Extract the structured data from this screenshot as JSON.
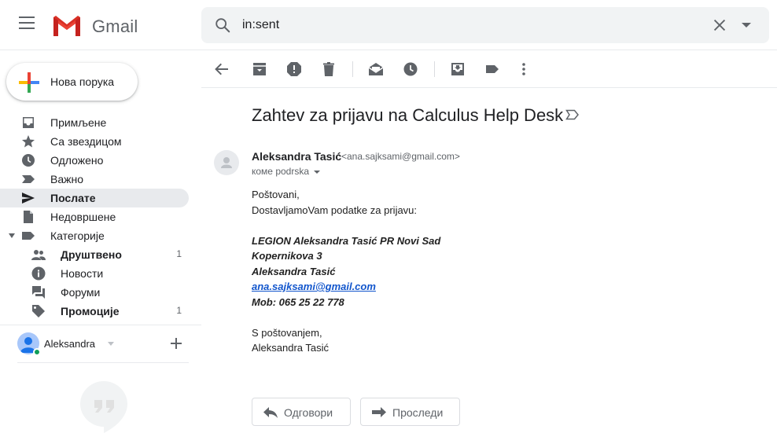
{
  "header": {
    "app_name": "Gmail",
    "search_value": "in:sent"
  },
  "sidebar": {
    "compose_label": "Нова порука",
    "items": [
      {
        "label": "Примљене",
        "icon": "inbox-icon"
      },
      {
        "label": "Са звездицом",
        "icon": "star-icon"
      },
      {
        "label": "Одложено",
        "icon": "clock-icon"
      },
      {
        "label": "Важно",
        "icon": "important-icon"
      },
      {
        "label": "Послате",
        "icon": "send-icon"
      },
      {
        "label": "Недовршене",
        "icon": "draft-icon"
      },
      {
        "label": "Категорије",
        "icon": "label-icon"
      }
    ],
    "categories": [
      {
        "label": "Друштвено",
        "count": "1",
        "icon": "people-icon"
      },
      {
        "label": "Новости",
        "count": "",
        "icon": "info-icon"
      },
      {
        "label": "Форуми",
        "count": "",
        "icon": "forum-icon"
      },
      {
        "label": "Промоције",
        "count": "1",
        "icon": "tag-icon"
      }
    ],
    "account_name": "Aleksandra"
  },
  "message": {
    "subject": "Zahtev za prijavu na Calculus Help Desk",
    "sender_name": "Aleksandra Tasić",
    "sender_email": "<ana.sajksami@gmail.com>",
    "to_line": "коме podrska",
    "body": {
      "greeting": "Poštovani,",
      "intro": "DostavljamoVam podatke za prijavu:",
      "company": "LEGION Aleksandra Tasić PR Novi Sad",
      "address": "Kopernikova 3",
      "person": "Aleksandra Tasić",
      "email": "ana.sajksami@gmail.com",
      "mobile": "Mob: 065 25 22 778",
      "closing": "S poštovanjem,",
      "signature": "Aleksandra Tasić"
    },
    "reply_label": "Одговори",
    "forward_label": "Проследи"
  },
  "colors": {
    "active_bg": "#e8eaed",
    "link": "#1155cc",
    "icon_gray": "#5f6368"
  }
}
